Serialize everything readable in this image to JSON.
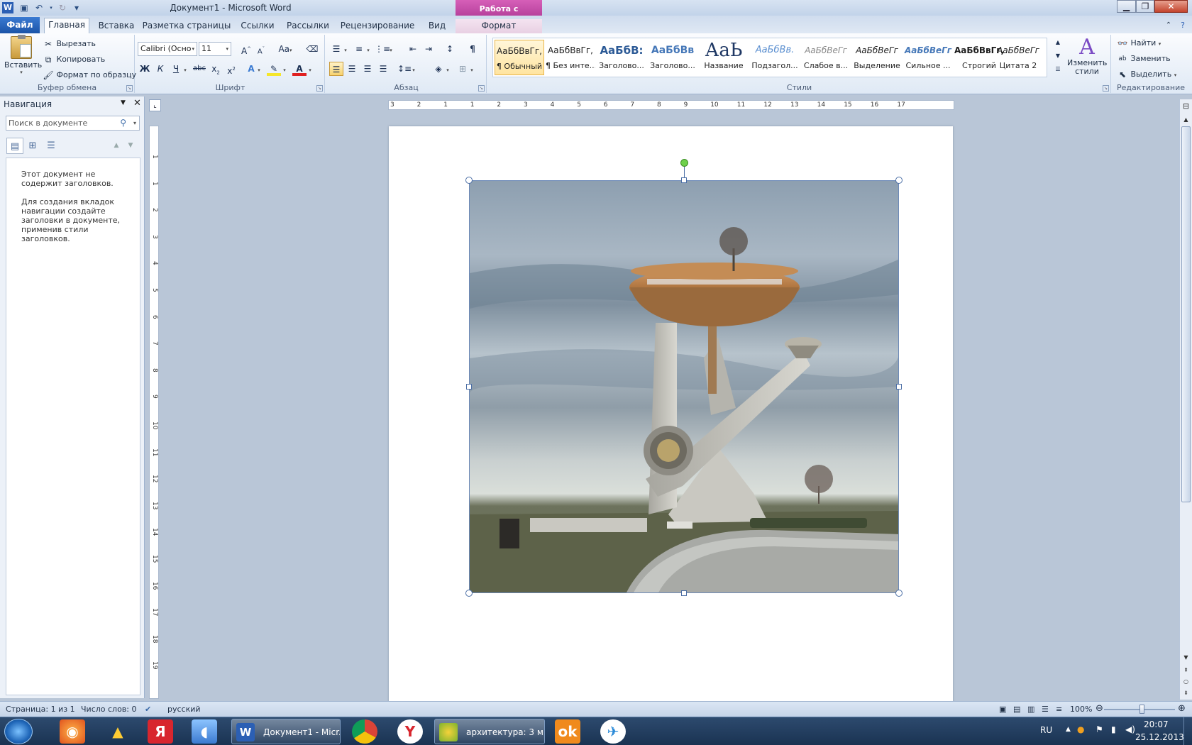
{
  "titlebar": {
    "title": "Документ1  -  Microsoft Word",
    "contextual_tab_group": "Работа с рисунками"
  },
  "tabs": {
    "file": "Файл",
    "home": "Главная",
    "insert": "Вставка",
    "page_layout": "Разметка страницы",
    "references": "Ссылки",
    "mailings": "Рассылки",
    "review": "Рецензирование",
    "view": "Вид",
    "format": "Формат"
  },
  "clipboard": {
    "paste": "Вставить",
    "cut": "Вырезать",
    "copy": "Копировать",
    "format_painter": "Формат по образцу",
    "label": "Буфер обмена"
  },
  "font": {
    "name": "Calibri (Осно",
    "size": "11",
    "bold": "Ж",
    "italic": "К",
    "underline": "Ч",
    "strike": "abc",
    "change_case": "Aa",
    "label": "Шрифт"
  },
  "paragraph": {
    "label": "Абзац"
  },
  "styles": {
    "items": [
      {
        "sample": "АаБбВвГг,",
        "name": "¶ Обычный"
      },
      {
        "sample": "АаБбВвГг,",
        "name": "¶ Без инте..."
      },
      {
        "sample": "АаБбВ:",
        "name": "Заголово..."
      },
      {
        "sample": "АаБбВв",
        "name": "Заголово..."
      },
      {
        "sample": "АаЬ",
        "name": "Название"
      },
      {
        "sample": "АаБбВв.",
        "name": "Подзагол..."
      },
      {
        "sample": "АаБбВеГг",
        "name": "Слабое в..."
      },
      {
        "sample": "АаБбВеГг",
        "name": "Выделение"
      },
      {
        "sample": "АаБбВеГг",
        "name": "Сильное ..."
      },
      {
        "sample": "АаБбВвГг,",
        "name": "Строгий"
      },
      {
        "sample": "АаБбВеГг",
        "name": "Цитата 2"
      }
    ],
    "change_styles": "Изменить стили",
    "label": "Стили"
  },
  "editing": {
    "find": "Найти",
    "replace": "Заменить",
    "select": "Выделить",
    "label": "Редактирование"
  },
  "navigation": {
    "title": "Навигация",
    "search_placeholder": "Поиск в документе",
    "message1": "Этот документ не содержит заголовков.",
    "message2": "Для создания вкладок навигации создайте заголовки в документе, применив стили заголовков."
  },
  "ruler": {
    "h_ticks": [
      "3",
      "2",
      "1",
      "1",
      "2",
      "3",
      "4",
      "5",
      "6",
      "7",
      "8",
      "9",
      "10",
      "11",
      "12",
      "13",
      "14",
      "15",
      "16",
      "17"
    ],
    "v_ticks": [
      "1",
      "1",
      "2",
      "3",
      "4",
      "5",
      "6",
      "7",
      "8",
      "9",
      "10",
      "11",
      "12",
      "13",
      "14",
      "15",
      "16",
      "17",
      "18",
      "19"
    ]
  },
  "status": {
    "page": "Страница: 1 из 1",
    "words": "Число слов: 0",
    "language": "русский",
    "zoom": "100%"
  },
  "taskbar": {
    "word_task": "Документ1 - Micr...",
    "browser_task": "архитектура: 3 м...",
    "lang": "RU",
    "time": "20:07",
    "date": "25.12.2013"
  },
  "colors": {
    "file_tab": "#1b54a8",
    "contextual_tab": "#b23c98",
    "selection_handle_rotate": "#6ed04b"
  }
}
